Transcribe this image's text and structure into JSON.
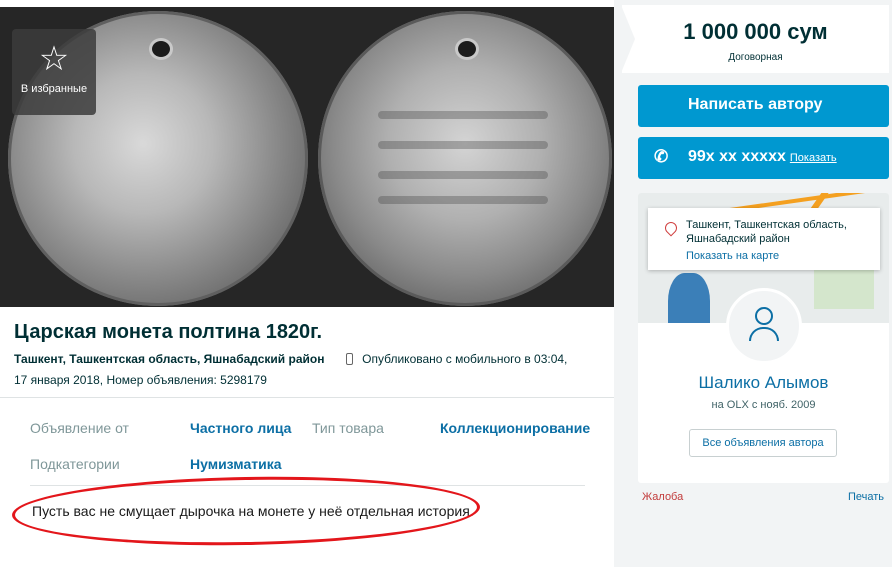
{
  "photo": {
    "favorite_icon": "star-icon",
    "favorite_label": "В избранные"
  },
  "listing": {
    "title": "Царская монета полтина 1820г.",
    "location": "Ташкент, Ташкентская область, Яшнабадский район",
    "published": "Опубликовано с мобильного",
    "time": "в 03:04,",
    "date_id": "17 января 2018, Номер объявления: 5298179"
  },
  "params": {
    "from_key": "Объявление от",
    "from_val": "Частного лица",
    "type_key": "Тип товара",
    "type_val": "Коллекционирование",
    "subcat_key": "Подкатегории",
    "subcat_val": "Нумизматика"
  },
  "description": "Пусть вас не смущает дырочка на монете у неё отдельная история.",
  "sidebar": {
    "price": "1 000 000 сум",
    "negotiable": "Договорная",
    "write_btn": "Написать автору",
    "phone": "99x xx xxxxx",
    "show_label": "Показать",
    "location": "Ташкент, Ташкентская область, Яшнабадский район",
    "map_link": "Показать на карте",
    "author_name": "Шалико Алымов",
    "author_since": "на OLX с нояб. 2009",
    "all_ads": "Все объявления автора",
    "complain": "Жалоба",
    "print": "Печать"
  },
  "colors": {
    "accent": "#0098d0",
    "link": "#0c6fa5",
    "highlight_ellipse": "#e3161b"
  }
}
